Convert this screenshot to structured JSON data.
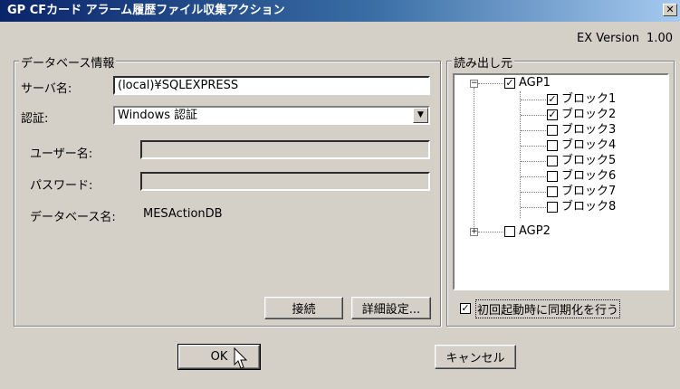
{
  "window": {
    "title": "GP CFカード アラーム履歴ファイル収集アクション",
    "close_label": "✕"
  },
  "version": {
    "label": "EX Version",
    "number": "1.00"
  },
  "database": {
    "legend": "データベース情報",
    "server_label": "サーバ名:",
    "server_value": "(local)¥SQLEXPRESS",
    "auth_label": "認証:",
    "auth_value": "Windows 認証",
    "username_label": "ユーザー名:",
    "username_value": "",
    "password_label": "パスワード:",
    "password_value": "",
    "dbname_label": "データベース名:",
    "dbname_value": "MESActionDB",
    "connect_button": "接続",
    "advanced_button": "詳細設定..."
  },
  "source": {
    "legend": "読み出し元",
    "nodes": [
      {
        "label": "AGP1",
        "checked": true,
        "expanded": true,
        "children": [
          {
            "label": "ブロック1",
            "checked": true
          },
          {
            "label": "ブロック2",
            "checked": true
          },
          {
            "label": "ブロック3",
            "checked": false
          },
          {
            "label": "ブロック4",
            "checked": false
          },
          {
            "label": "ブロック5",
            "checked": false
          },
          {
            "label": "ブロック6",
            "checked": false
          },
          {
            "label": "ブロック7",
            "checked": false
          },
          {
            "label": "ブロック8",
            "checked": false
          }
        ]
      },
      {
        "label": "AGP2",
        "checked": false,
        "expanded": false,
        "children": []
      }
    ],
    "sync_label": "初回起動時に同期化を行う",
    "sync_checked": true
  },
  "buttons": {
    "ok": "OK",
    "cancel": "キャンセル"
  },
  "icons": {
    "close": "close-icon",
    "dropdown": "chevron-down-icon",
    "check": "checkmark-icon",
    "expand": "plus-icon",
    "collapse": "minus-icon",
    "cursor": "mouse-pointer-icon"
  }
}
